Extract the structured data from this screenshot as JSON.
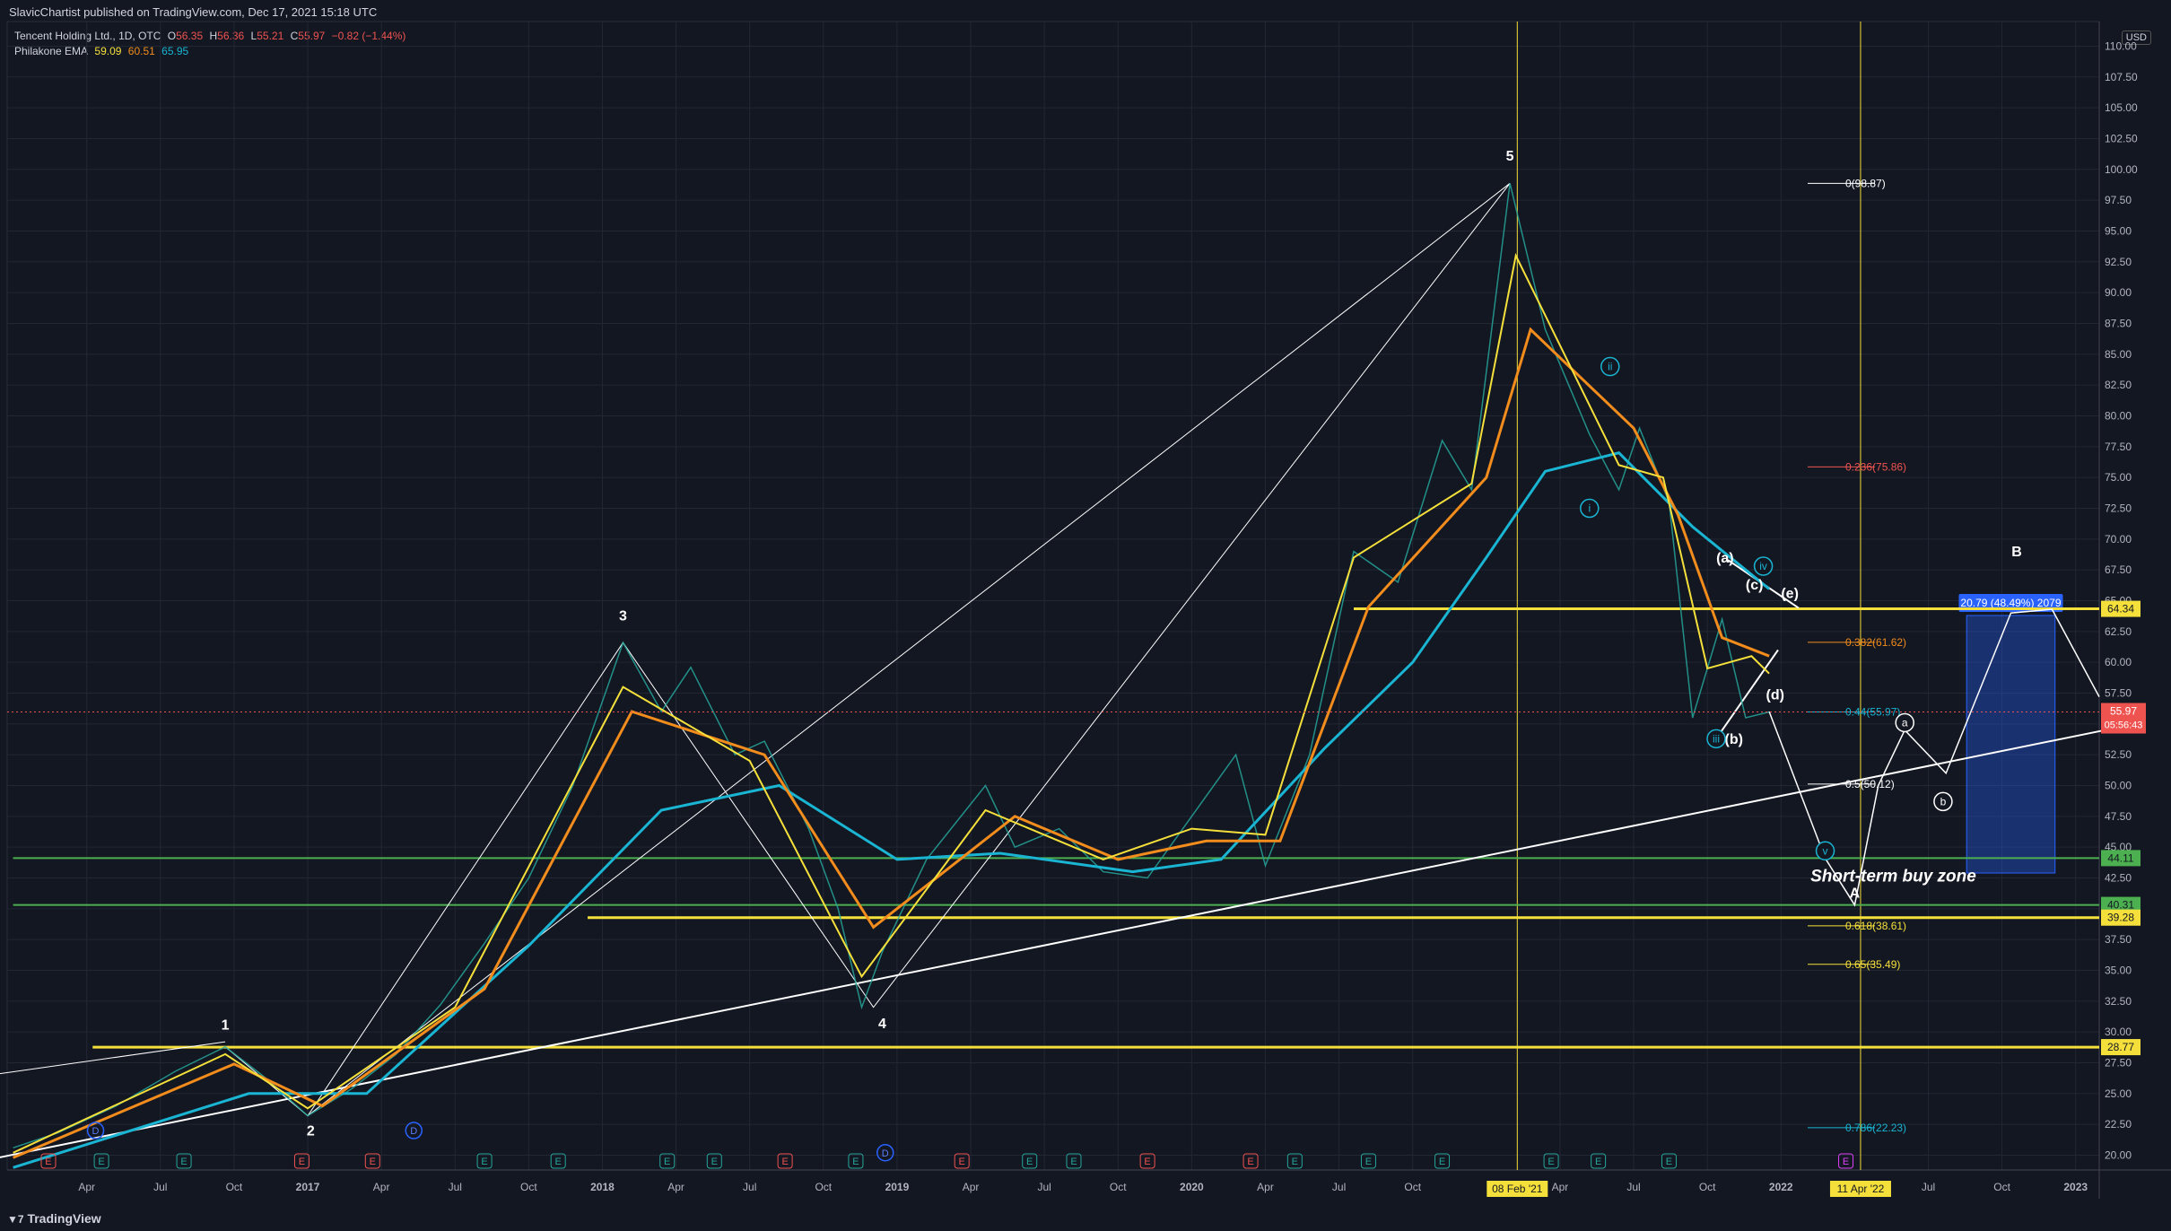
{
  "header": {
    "publisher_line": "SlavicChartist published on TradingView.com, Dec 17, 2021 15:18 UTC"
  },
  "legend": {
    "symbol": "Tencent Holding Ltd., 1D, OTC",
    "open_label": "O",
    "open": "56.35",
    "high_label": "H",
    "high": "56.36",
    "low_label": "L",
    "low": "55.21",
    "close_label": "C",
    "close": "55.97",
    "change": "−0.82 (−1.44%)",
    "indicator": "Philakone EMA",
    "ema_values": [
      "59.09",
      "60.51",
      "65.95"
    ]
  },
  "currency": "USD",
  "footer": {
    "brand": "TradingView"
  },
  "colors": {
    "background": "#131722",
    "grid": "#232734",
    "price_up": "#26a69a",
    "price_down": "#ef5350",
    "ema_fast": "#f5e03b",
    "ema_mid": "#f28c1c",
    "ema_slow": "#19b5d3",
    "level_yellow": "#f5e03b",
    "level_green": "#4caf50",
    "measure_blue": "#2962ff"
  },
  "chart_data": {
    "type": "line",
    "title": "Tencent Holding Ltd., 1D, OTC",
    "y_ticks": [
      "20.00",
      "22.50",
      "25.00",
      "27.50",
      "30.00",
      "32.50",
      "35.00",
      "37.50",
      "40.00",
      "42.50",
      "45.00",
      "47.50",
      "50.00",
      "52.50",
      "55.00",
      "57.50",
      "60.00",
      "62.50",
      "65.00",
      "67.50",
      "70.00",
      "72.50",
      "75.00",
      "77.50",
      "80.00",
      "82.50",
      "85.00",
      "87.50",
      "90.00",
      "92.50",
      "95.00",
      "97.50",
      "100.00",
      "102.50",
      "105.00",
      "107.50",
      "110.00"
    ],
    "x_ticks": [
      {
        "label": "Apr",
        "date": 2016.25
      },
      {
        "label": "Jul",
        "date": 2016.5
      },
      {
        "label": "Oct",
        "date": 2016.75
      },
      {
        "label": "2017",
        "date": 2017.0,
        "bold": true
      },
      {
        "label": "Apr",
        "date": 2017.25
      },
      {
        "label": "Jul",
        "date": 2017.5
      },
      {
        "label": "Oct",
        "date": 2017.75
      },
      {
        "label": "2018",
        "date": 2018.0,
        "bold": true
      },
      {
        "label": "Apr",
        "date": 2018.25
      },
      {
        "label": "Jul",
        "date": 2018.5
      },
      {
        "label": "Oct",
        "date": 2018.75
      },
      {
        "label": "2019",
        "date": 2019.0,
        "bold": true
      },
      {
        "label": "Apr",
        "date": 2019.25
      },
      {
        "label": "Jul",
        "date": 2019.5
      },
      {
        "label": "Oct",
        "date": 2019.75
      },
      {
        "label": "2020",
        "date": 2020.0,
        "bold": true
      },
      {
        "label": "Apr",
        "date": 2020.25
      },
      {
        "label": "Jul",
        "date": 2020.5
      },
      {
        "label": "Oct",
        "date": 2020.75
      },
      {
        "label": "Apr",
        "date": 2021.25
      },
      {
        "label": "Jul",
        "date": 2021.5
      },
      {
        "label": "Oct",
        "date": 2021.75
      },
      {
        "label": "2022",
        "date": 2022.0,
        "bold": true
      },
      {
        "label": "Jul",
        "date": 2022.5
      },
      {
        "label": "Oct",
        "date": 2022.75
      },
      {
        "label": "2023",
        "date": 2023.0,
        "bold": true
      }
    ],
    "x_range": [
      2015.98,
      2023.08
    ],
    "y_range": [
      18.8,
      112.0
    ],
    "log_scale": false,
    "grid": true,
    "price_path": [
      [
        2016.0,
        20.6
      ],
      [
        2016.15,
        21.8
      ],
      [
        2016.35,
        24.0
      ],
      [
        2016.55,
        26.8
      ],
      [
        2016.72,
        28.8
      ],
      [
        2016.85,
        26.4
      ],
      [
        2017.0,
        23.2
      ],
      [
        2017.15,
        25.4
      ],
      [
        2017.3,
        28.2
      ],
      [
        2017.45,
        32.2
      ],
      [
        2017.6,
        37.2
      ],
      [
        2017.75,
        42.5
      ],
      [
        2017.9,
        50.0
      ],
      [
        2018.07,
        61.6
      ],
      [
        2018.2,
        56.0
      ],
      [
        2018.3,
        59.6
      ],
      [
        2018.45,
        52.5
      ],
      [
        2018.55,
        53.6
      ],
      [
        2018.7,
        46.5
      ],
      [
        2018.8,
        40.0
      ],
      [
        2018.88,
        32.0
      ],
      [
        2018.95,
        36.5
      ],
      [
        2019.1,
        44.0
      ],
      [
        2019.3,
        50.0
      ],
      [
        2019.4,
        45.0
      ],
      [
        2019.55,
        46.5
      ],
      [
        2019.7,
        43.0
      ],
      [
        2019.85,
        42.5
      ],
      [
        2020.0,
        47.5
      ],
      [
        2020.15,
        52.5
      ],
      [
        2020.25,
        43.5
      ],
      [
        2020.4,
        52.5
      ],
      [
        2020.55,
        69.0
      ],
      [
        2020.7,
        66.5
      ],
      [
        2020.85,
        78.0
      ],
      [
        2020.95,
        74.0
      ],
      [
        2021.08,
        98.87
      ],
      [
        2021.2,
        87.0
      ],
      [
        2021.35,
        78.5
      ],
      [
        2021.45,
        74.0
      ],
      [
        2021.52,
        79.0
      ],
      [
        2021.62,
        73.0
      ],
      [
        2021.7,
        55.5
      ],
      [
        2021.8,
        63.5
      ],
      [
        2021.88,
        55.5
      ],
      [
        2021.96,
        55.97
      ]
    ],
    "ema_fast_path": [
      [
        2016.0,
        20.2
      ],
      [
        2016.72,
        28.2
      ],
      [
        2017.0,
        23.8
      ],
      [
        2017.5,
        32.0
      ],
      [
        2018.07,
        58.0
      ],
      [
        2018.5,
        52.0
      ],
      [
        2018.88,
        34.5
      ],
      [
        2019.3,
        48.0
      ],
      [
        2019.7,
        44.0
      ],
      [
        2020.0,
        46.5
      ],
      [
        2020.25,
        46.0
      ],
      [
        2020.55,
        68.5
      ],
      [
        2020.95,
        74.5
      ],
      [
        2021.1,
        93.0
      ],
      [
        2021.45,
        76.0
      ],
      [
        2021.6,
        75.0
      ],
      [
        2021.75,
        59.5
      ],
      [
        2021.9,
        60.5
      ],
      [
        2021.96,
        59.09
      ]
    ],
    "ema_mid_path": [
      [
        2016.0,
        19.8
      ],
      [
        2016.75,
        27.4
      ],
      [
        2017.05,
        24.0
      ],
      [
        2017.6,
        33.5
      ],
      [
        2018.1,
        56.0
      ],
      [
        2018.55,
        52.5
      ],
      [
        2018.92,
        38.5
      ],
      [
        2019.4,
        47.5
      ],
      [
        2019.75,
        44.0
      ],
      [
        2020.05,
        45.5
      ],
      [
        2020.3,
        45.5
      ],
      [
        2020.6,
        64.5
      ],
      [
        2021.0,
        75.0
      ],
      [
        2021.15,
        87.0
      ],
      [
        2021.5,
        79.0
      ],
      [
        2021.65,
        72.0
      ],
      [
        2021.8,
        62.0
      ],
      [
        2021.96,
        60.51
      ]
    ],
    "ema_slow_path": [
      [
        2016.0,
        19.0
      ],
      [
        2016.8,
        25.0
      ],
      [
        2017.2,
        25.0
      ],
      [
        2017.75,
        37.0
      ],
      [
        2018.2,
        48.0
      ],
      [
        2018.6,
        50.0
      ],
      [
        2019.0,
        44.0
      ],
      [
        2019.35,
        44.5
      ],
      [
        2019.8,
        43.0
      ],
      [
        2020.1,
        44.0
      ],
      [
        2020.45,
        53.0
      ],
      [
        2020.75,
        60.0
      ],
      [
        2021.0,
        68.5
      ],
      [
        2021.2,
        75.5
      ],
      [
        2021.45,
        77.0
      ],
      [
        2021.7,
        71.0
      ],
      [
        2021.96,
        65.95
      ]
    ],
    "elliott_path": [
      [
        2016.72,
        28.8
      ],
      [
        2017.0,
        23.2
      ],
      [
        2018.07,
        61.6
      ],
      [
        2018.92,
        32.0
      ],
      [
        2021.08,
        98.87
      ]
    ],
    "fibonacci": [
      {
        "ratio": "0(98.87)",
        "price": 98.87,
        "color": "#ffffff"
      },
      {
        "ratio": "0.236(75.86)",
        "price": 75.86,
        "color": "#ef5350"
      },
      {
        "ratio": "0.382(61.62)",
        "price": 61.62,
        "color": "#f28c1c"
      },
      {
        "ratio": "0.44(55.97)",
        "price": 55.97,
        "color": "#19b5d3"
      },
      {
        "ratio": "0.5(50.12)",
        "price": 50.12,
        "color": "#ffffff"
      },
      {
        "ratio": "0.618(38.61)",
        "price": 38.61,
        "color": "#f5e03b"
      },
      {
        "ratio": "0.65(35.49)",
        "price": 35.49,
        "color": "#f5e03b"
      },
      {
        "ratio": "0.786(22.23)",
        "price": 22.23,
        "color": "#19b5d3"
      }
    ],
    "horizontal_levels": [
      {
        "price": 64.34,
        "label": "64.34",
        "color": "#f5e03b",
        "from": 2020.55
      },
      {
        "price": 44.11,
        "label": "44.11",
        "color": "#4caf50",
        "from": 2016.0
      },
      {
        "price": 40.31,
        "label": "40.31",
        "color": "#4caf50",
        "from": 2016.0
      },
      {
        "price": 39.28,
        "label": "39.28",
        "color": "#f5e03b",
        "from": 2017.95
      },
      {
        "price": 28.77,
        "label": "28.77",
        "color": "#f5e03b",
        "from": 2016.27
      }
    ],
    "price_labels": [
      {
        "price": 55.97,
        "label": "55.97",
        "sub": "05:56:43",
        "color": "#ef5350"
      }
    ],
    "vertical_markers": [
      {
        "date": 2021.105,
        "label": "08 Feb '21"
      },
      {
        "date": 2022.27,
        "label": "11 Apr '22"
      }
    ],
    "wave_labels": [
      {
        "text": "1",
        "date": 2016.72,
        "price": 30.2
      },
      {
        "text": "2",
        "date": 2017.01,
        "price": 21.6
      },
      {
        "text": "3",
        "date": 2018.07,
        "price": 63.4
      },
      {
        "text": "4",
        "date": 2018.95,
        "price": 30.3
      },
      {
        "text": "5",
        "date": 2021.08,
        "price": 100.7
      },
      {
        "text": "B",
        "date": 2022.8,
        "price": 68.6
      },
      {
        "text": "A",
        "date": 2022.25,
        "price": 40.9
      },
      {
        "text": "(a)",
        "date": 2021.81,
        "price": 68.1
      },
      {
        "text": "(b)",
        "date": 2021.84,
        "price": 53.4
      },
      {
        "text": "(c)",
        "date": 2021.91,
        "price": 65.9
      },
      {
        "text": "(d)",
        "date": 2021.98,
        "price": 57.0
      },
      {
        "text": "(e)",
        "date": 2022.03,
        "price": 65.2
      }
    ],
    "circled_labels": [
      {
        "text": "i",
        "date": 2021.35,
        "price": 72.5,
        "color": "#19b5d3"
      },
      {
        "text": "ii",
        "date": 2021.42,
        "price": 84.0,
        "color": "#19b5d3"
      },
      {
        "text": "iii",
        "date": 2021.78,
        "price": 53.8,
        "color": "#19b5d3"
      },
      {
        "text": "iv",
        "date": 2021.94,
        "price": 67.8,
        "color": "#19b5d3"
      },
      {
        "text": "v",
        "date": 2022.15,
        "price": 44.7,
        "color": "#19b5d3"
      },
      {
        "text": "a",
        "date": 2022.42,
        "price": 55.1,
        "color": "#ffffff"
      },
      {
        "text": "b",
        "date": 2022.55,
        "price": 48.7,
        "color": "#ffffff"
      }
    ],
    "trendlines": [
      {
        "from": [
          2015.95,
          19.8
        ],
        "to": [
          2023.1,
          54.5
        ],
        "color": "#ffffff",
        "width": 2
      },
      {
        "from": [
          2015.95,
          26.6
        ],
        "to": [
          2016.72,
          29.2
        ],
        "color": "#ffffff",
        "width": 1
      },
      {
        "from": [
          2017.0,
          23.2
        ],
        "to": [
          2021.08,
          98.87
        ],
        "color": "#ffffff",
        "width": 1
      },
      {
        "from": [
          2021.82,
          68.3
        ],
        "to": [
          2022.06,
          64.4
        ],
        "color": "#ffffff",
        "width": 2
      },
      {
        "from": [
          2021.78,
          53.8
        ],
        "to": [
          2021.99,
          61.0
        ],
        "color": "#ffffff",
        "width": 2
      }
    ],
    "projection_path": [
      [
        2021.96,
        56.0
      ],
      [
        2022.15,
        44.1
      ],
      [
        2022.25,
        40.3
      ],
      [
        2022.33,
        50.0
      ],
      [
        2022.42,
        54.5
      ],
      [
        2022.56,
        51.0
      ],
      [
        2022.78,
        64.0
      ],
      [
        2022.92,
        64.3
      ],
      [
        2023.08,
        57.2
      ]
    ],
    "measure_box": {
      "x0": 2022.63,
      "x1": 2022.93,
      "y0": 42.9,
      "y1": 63.8,
      "label": "20.79 (48.49%) 2079"
    },
    "annotation": "Short-term buy zone",
    "earnings_markers": [
      {
        "text": "E",
        "date": 2016.12,
        "color": "#ef5350"
      },
      {
        "text": "E",
        "date": 2016.3,
        "color": "#26a69a"
      },
      {
        "text": "E",
        "date": 2016.58,
        "color": "#26a69a"
      },
      {
        "text": "E",
        "date": 2016.98,
        "color": "#ef5350"
      },
      {
        "text": "E",
        "date": 2017.22,
        "color": "#ef5350"
      },
      {
        "text": "E",
        "date": 2017.6,
        "color": "#26a69a"
      },
      {
        "text": "E",
        "date": 2017.85,
        "color": "#26a69a"
      },
      {
        "text": "E",
        "date": 2018.22,
        "color": "#26a69a"
      },
      {
        "text": "E",
        "date": 2018.38,
        "color": "#26a69a"
      },
      {
        "text": "E",
        "date": 2018.62,
        "color": "#ef5350"
      },
      {
        "text": "E",
        "date": 2018.86,
        "color": "#26a69a"
      },
      {
        "text": "E",
        "date": 2019.22,
        "color": "#ef5350"
      },
      {
        "text": "E",
        "date": 2019.45,
        "color": "#26a69a"
      },
      {
        "text": "E",
        "date": 2019.6,
        "color": "#26a69a"
      },
      {
        "text": "E",
        "date": 2019.85,
        "color": "#ef5350"
      },
      {
        "text": "E",
        "date": 2020.2,
        "color": "#ef5350"
      },
      {
        "text": "E",
        "date": 2020.35,
        "color": "#26a69a"
      },
      {
        "text": "E",
        "date": 2020.6,
        "color": "#26a69a"
      },
      {
        "text": "E",
        "date": 2020.85,
        "color": "#26a69a"
      },
      {
        "text": "E",
        "date": 2021.22,
        "color": "#26a69a"
      },
      {
        "text": "E",
        "date": 2021.38,
        "color": "#26a69a"
      },
      {
        "text": "E",
        "date": 2021.62,
        "color": "#26a69a"
      },
      {
        "text": "E",
        "date": 2022.22,
        "color": "#e040fb"
      }
    ],
    "dividend_markers": [
      {
        "text": "D",
        "date": 2016.28,
        "price": 22.0
      },
      {
        "text": "D",
        "date": 2017.36,
        "price": 22.0
      },
      {
        "text": "D",
        "date": 2018.96,
        "price": 20.2
      }
    ]
  }
}
